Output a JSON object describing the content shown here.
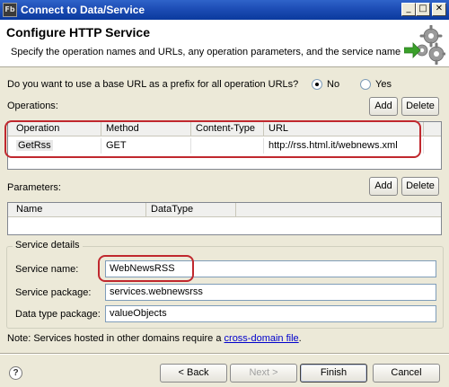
{
  "window": {
    "title": "Connect to Data/Service",
    "app_icon_text": "Fb",
    "controls": [
      "_",
      "□",
      "✕"
    ]
  },
  "header": {
    "title": "Configure HTTP Service",
    "subtitle": "Specify the operation names and URLs, any operation parameters, and the service name",
    "icon": "gears-icon"
  },
  "base_url": {
    "question": "Do you want to use a base URL as a prefix for all operation URLs?",
    "options": [
      "No",
      "Yes"
    ],
    "selected": "No"
  },
  "operations": {
    "label": "Operations:",
    "add_label": "Add",
    "delete_label": "Delete",
    "columns": [
      "Operation",
      "Method",
      "Content-Type",
      "URL"
    ],
    "rows": [
      {
        "operation": "GetRss",
        "method": "GET",
        "content_type": "",
        "url": "http://rss.html.it/webnews.xml"
      }
    ]
  },
  "parameters": {
    "label": "Parameters:",
    "add_label": "Add",
    "delete_label": "Delete",
    "columns": [
      "Name",
      "DataType"
    ]
  },
  "service_details": {
    "title": "Service details",
    "name_label": "Service name:",
    "name_value": "WebNewsRSS",
    "package_label": "Service package:",
    "package_value": "services.webnewsrss",
    "dtpackage_label": "Data type package:",
    "dtpackage_value": "valueObjects"
  },
  "note": {
    "text": "Note: Services hosted in other domains require a",
    "link": "cross-domain file",
    "end": "."
  },
  "footer": {
    "help": "?",
    "back": "< Back",
    "next": "Next >",
    "finish": "Finish",
    "cancel": "Cancel"
  },
  "colors": {
    "highlight": "#c0282e",
    "titlebar": "#1d4db5"
  }
}
